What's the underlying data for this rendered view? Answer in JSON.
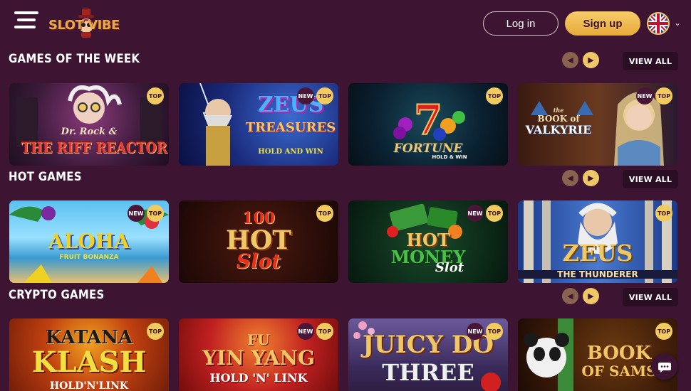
{
  "header": {
    "logo_text": "SLOT VIBE",
    "login_label": "Log in",
    "signup_label": "Sign up",
    "language_icon": "uk-flag-icon",
    "menu_icon": "hamburger-menu-icon"
  },
  "colors": {
    "background": "#3d1533",
    "accent": "#f0c766",
    "view_all_bg": "#2a0e23"
  },
  "sections": [
    {
      "title": "GAMES OF THE WEEK",
      "view_all": "VIEW ALL",
      "games": [
        {
          "title_line1": "Dr. Rock &",
          "title_line2": "THE RIFF REACTOR",
          "badges": [
            "TOP"
          ]
        },
        {
          "title_line1": "ZEUS",
          "title_line2": "TREASURES",
          "title_line3": "HOLD AND WIN",
          "badges": [
            "NEW",
            "TOP"
          ]
        },
        {
          "title_line1": "FORTUNE",
          "title_line2": "HOLD & WIN",
          "badges": [
            "TOP"
          ]
        },
        {
          "title_line1": "the",
          "title_line2": "BOOK of",
          "title_line3": "VALKYRIE",
          "badges": [
            "NEW",
            "TOP"
          ]
        }
      ]
    },
    {
      "title": "HOT GAMES",
      "view_all": "VIEW ALL",
      "games": [
        {
          "title_line1": "ALOHA",
          "title_line2": "FRUIT BONANZA",
          "badges": [
            "NEW",
            "TOP"
          ]
        },
        {
          "title_line1": "100",
          "title_line2": "HOT",
          "title_line3": "Slot",
          "badges": [
            "TOP"
          ]
        },
        {
          "title_line1": "HOT",
          "title_line2": "MONEY",
          "title_line3": "Slot",
          "badges": [
            "NEW",
            "TOP"
          ]
        },
        {
          "title_line1": "ZEUS",
          "title_line2": "THE THUNDERER",
          "badges": [
            "TOP"
          ]
        }
      ]
    },
    {
      "title": "CRYPTO GAMES",
      "view_all": "VIEW ALL",
      "games": [
        {
          "title_line1": "KATANA",
          "title_line2": "KLASH",
          "title_line3": "HOLD'N'LINK",
          "badges": [
            "TOP"
          ]
        },
        {
          "title_line1": "FU",
          "title_line2": "YIN YANG",
          "title_line3": "HOLD 'N' LINK",
          "badges": [
            "NEW",
            "TOP"
          ]
        },
        {
          "title_line1": "JUICY DO",
          "title_line2": "THREE",
          "badges": [
            "NEW",
            "TOP"
          ]
        },
        {
          "title_line1": "BOOK",
          "title_line2": "OF SAMS",
          "badges": [
            "TOP"
          ]
        }
      ]
    }
  ],
  "chat_icon": "chat-bubble-icon"
}
